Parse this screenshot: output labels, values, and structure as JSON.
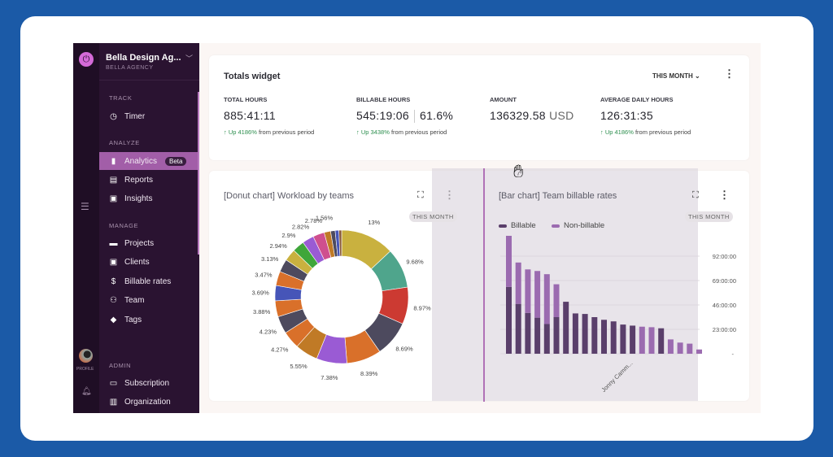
{
  "sidebar": {
    "workspace": "Bella Design Ag...",
    "workspace_sub": "BELLA AGENCY",
    "rail": {
      "profile_label": "PROFILE"
    },
    "sections": {
      "track": "TRACK",
      "analyze": "ANALYZE",
      "manage": "MANAGE",
      "admin": "ADMIN"
    },
    "items": [
      {
        "label": "Timer",
        "icon": "clock-icon"
      },
      {
        "label": "Analytics",
        "icon": "bar-chart-icon",
        "badge": "Beta",
        "active": true
      },
      {
        "label": "Reports",
        "icon": "document-icon"
      },
      {
        "label": "Insights",
        "icon": "insights-icon"
      },
      {
        "label": "Projects",
        "icon": "folder-icon"
      },
      {
        "label": "Clients",
        "icon": "contact-icon"
      },
      {
        "label": "Billable rates",
        "icon": "dollar-icon"
      },
      {
        "label": "Team",
        "icon": "team-icon"
      },
      {
        "label": "Tags",
        "icon": "tag-icon"
      },
      {
        "label": "Subscription",
        "icon": "card-icon"
      },
      {
        "label": "Organization",
        "icon": "building-icon"
      }
    ]
  },
  "totals": {
    "title": "Totals widget",
    "period": "THIS MONTH",
    "stats": [
      {
        "label": "TOTAL HOURS",
        "value": "885:41:11",
        "change": "Up 4186%",
        "change_suffix": "from previous period"
      },
      {
        "label": "BILLABLE HOURS",
        "value": "545:19:06",
        "extra": "61.6%",
        "change": "Up 3438%",
        "change_suffix": "from previous period"
      },
      {
        "label": "AMOUNT",
        "value": "136329.58",
        "unit": "USD"
      },
      {
        "label": "AVERAGE DAILY HOURS",
        "value": "126:31:35",
        "change": "Up 4186%",
        "change_suffix": "from previous period"
      }
    ],
    "accent_green": "#2e8f4f"
  },
  "chart_data": [
    {
      "type": "pie",
      "title": "[Donut chart] Workload by teams",
      "period": "THIS MONTH",
      "values": [
        13,
        9.68,
        8.97,
        8.69,
        8.39,
        7.38,
        5.55,
        4.27,
        4.23,
        3.88,
        3.69,
        3.47,
        3.13,
        2.94,
        2.9,
        2.82,
        2.78,
        1.56,
        1.1,
        0.9,
        0.67
      ],
      "labels": [
        "13%",
        "9.68%",
        "8.97%",
        "8.69%",
        "8.39%",
        "7.38%",
        "5.55%",
        "4.27%",
        "4.23%",
        "3.88%",
        "3.69%",
        "3.47%",
        "3.13%",
        "2.94%",
        "2.9%",
        "2.82%",
        "2.78%",
        "1.56%",
        "",
        "",
        ""
      ],
      "colors": [
        "#c9b13f",
        "#4fa58c",
        "#cc3a32",
        "#4d4a5e",
        "#d9702a",
        "#9a5bd4",
        "#c07a26",
        "#d9702a",
        "#4d4a5e",
        "#d9702a",
        "#4655b8",
        "#d9702a",
        "#4d4a5e",
        "#c9b13f",
        "#3fa63a",
        "#9a5bd4",
        "#cf4f8e",
        "#c07a26",
        "#4d4a5e",
        "#4655b8",
        "#8a5a3a"
      ]
    },
    {
      "type": "bar",
      "stacked": true,
      "title": "[Bar chart] Team billable rates",
      "period": "THIS MONTH",
      "x_tick_labels": [
        "Jonny Camm..."
      ],
      "y_ticks": [
        "-",
        "23:00:00",
        "46:00:00",
        "69:00:00",
        "92:00:00"
      ],
      "ylim": [
        0,
        115
      ],
      "y_unit": "hours",
      "grid": true,
      "series": [
        {
          "name": "Billable",
          "color": "#5a3f6b",
          "values": [
            63,
            47,
            38.5,
            34,
            28,
            34.5,
            49,
            38,
            37.5,
            34.5,
            32,
            30.5,
            27.5,
            26.5,
            0,
            0,
            24,
            0,
            0,
            0,
            0
          ]
        },
        {
          "name": "Non-billable",
          "color": "#9b6bb0",
          "values": [
            52,
            39,
            41,
            44,
            47,
            31,
            0,
            0,
            0,
            0,
            0,
            0,
            0,
            0,
            25.5,
            25,
            0,
            13.5,
            10.5,
            9.5,
            4
          ]
        }
      ]
    }
  ]
}
